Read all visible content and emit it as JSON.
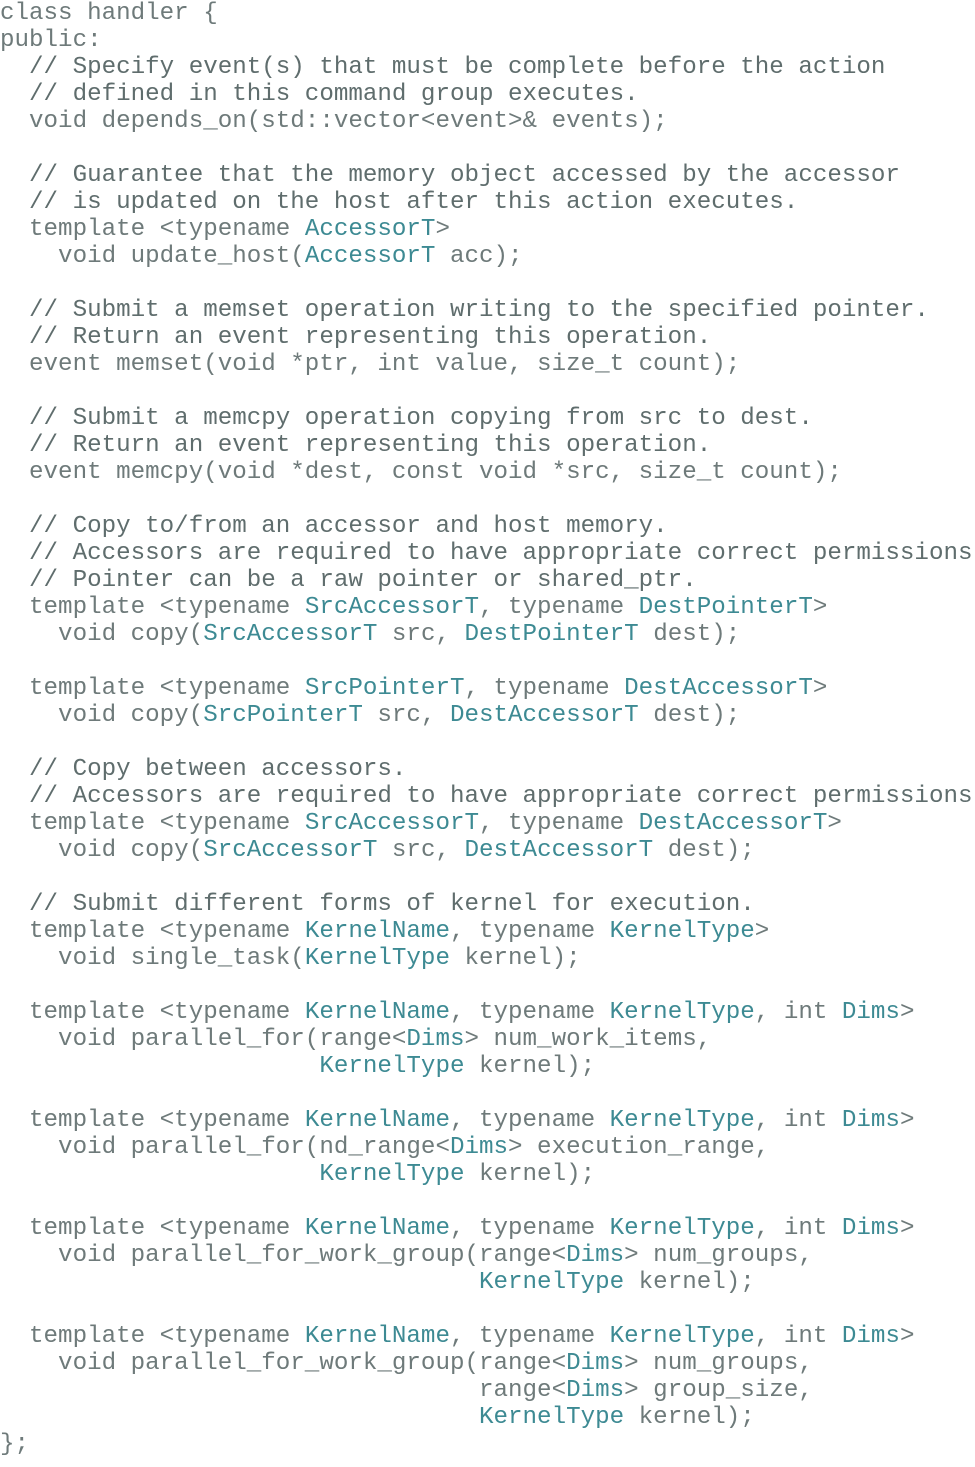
{
  "document": {
    "language": "C++",
    "colors": {
      "text": "#6e7a7a",
      "type_name": "#3d8a93",
      "background": "#ffffff"
    },
    "lines": [
      [
        {
          "t": "class handler {"
        }
      ],
      [
        {
          "t": "public:"
        }
      ],
      [
        {
          "t": "  // Specify event(s) that must be complete before the action",
          "k": "c"
        }
      ],
      [
        {
          "t": "  // defined in this command group executes.",
          "k": "c"
        }
      ],
      [
        {
          "t": "  void depends_on(std::vector<event>& events);"
        }
      ],
      [
        {
          "t": ""
        }
      ],
      [
        {
          "t": "  // Guarantee that the memory object accessed by the accessor",
          "k": "c"
        }
      ],
      [
        {
          "t": "  // is updated on the host after this action executes.",
          "k": "c"
        }
      ],
      [
        {
          "t": "  template <typename "
        },
        {
          "t": "AccessorT",
          "k": "ty"
        },
        {
          "t": ">"
        }
      ],
      [
        {
          "t": "    void update_host("
        },
        {
          "t": "AccessorT",
          "k": "ty"
        },
        {
          "t": " acc);"
        }
      ],
      [
        {
          "t": ""
        }
      ],
      [
        {
          "t": "  // Submit a memset operation writing to the specified pointer.",
          "k": "c"
        }
      ],
      [
        {
          "t": "  // Return an event representing this operation.",
          "k": "c"
        }
      ],
      [
        {
          "t": "  event memset(void *ptr, int value, size_t count);"
        }
      ],
      [
        {
          "t": ""
        }
      ],
      [
        {
          "t": "  // Submit a memcpy operation copying from src to dest.",
          "k": "c"
        }
      ],
      [
        {
          "t": "  // Return an event representing this operation.",
          "k": "c"
        }
      ],
      [
        {
          "t": "  event memcpy(void *dest, const void *src, size_t count);"
        }
      ],
      [
        {
          "t": ""
        }
      ],
      [
        {
          "t": "  // Copy to/from an accessor and host memory.",
          "k": "c"
        }
      ],
      [
        {
          "t": "  // Accessors are required to have appropriate correct permissions.",
          "k": "c"
        }
      ],
      [
        {
          "t": "  // Pointer can be a raw pointer or shared_ptr.",
          "k": "c"
        }
      ],
      [
        {
          "t": "  template <typename "
        },
        {
          "t": "SrcAccessorT",
          "k": "ty"
        },
        {
          "t": ", typename "
        },
        {
          "t": "DestPointerT",
          "k": "ty"
        },
        {
          "t": ">"
        }
      ],
      [
        {
          "t": "    void copy("
        },
        {
          "t": "SrcAccessorT",
          "k": "ty"
        },
        {
          "t": " src, "
        },
        {
          "t": "DestPointerT",
          "k": "ty"
        },
        {
          "t": " dest);"
        }
      ],
      [
        {
          "t": ""
        }
      ],
      [
        {
          "t": "  template <typename "
        },
        {
          "t": "SrcPointerT",
          "k": "ty"
        },
        {
          "t": ", typename "
        },
        {
          "t": "DestAccessorT",
          "k": "ty"
        },
        {
          "t": ">"
        }
      ],
      [
        {
          "t": "    void copy("
        },
        {
          "t": "SrcPointerT",
          "k": "ty"
        },
        {
          "t": " src, "
        },
        {
          "t": "DestAccessorT",
          "k": "ty"
        },
        {
          "t": " dest);"
        }
      ],
      [
        {
          "t": ""
        }
      ],
      [
        {
          "t": "  // Copy between accessors.",
          "k": "c"
        }
      ],
      [
        {
          "t": "  // Accessors are required to have appropriate correct permissions.",
          "k": "c"
        }
      ],
      [
        {
          "t": "  template <typename "
        },
        {
          "t": "SrcAccessorT",
          "k": "ty"
        },
        {
          "t": ", typename "
        },
        {
          "t": "DestAccessorT",
          "k": "ty"
        },
        {
          "t": ">"
        }
      ],
      [
        {
          "t": "    void copy("
        },
        {
          "t": "SrcAccessorT",
          "k": "ty"
        },
        {
          "t": " src, "
        },
        {
          "t": "DestAccessorT",
          "k": "ty"
        },
        {
          "t": " dest);"
        }
      ],
      [
        {
          "t": ""
        }
      ],
      [
        {
          "t": "  // Submit different forms of kernel for execution.",
          "k": "c"
        }
      ],
      [
        {
          "t": "  template <typename "
        },
        {
          "t": "KernelName",
          "k": "ty"
        },
        {
          "t": ", typename "
        },
        {
          "t": "KernelType",
          "k": "ty"
        },
        {
          "t": ">"
        }
      ],
      [
        {
          "t": "    void single_task("
        },
        {
          "t": "KernelType",
          "k": "ty"
        },
        {
          "t": " kernel);"
        }
      ],
      [
        {
          "t": ""
        }
      ],
      [
        {
          "t": "  template <typename "
        },
        {
          "t": "KernelName",
          "k": "ty"
        },
        {
          "t": ", typename "
        },
        {
          "t": "KernelType",
          "k": "ty"
        },
        {
          "t": ", int "
        },
        {
          "t": "Dims",
          "k": "ty"
        },
        {
          "t": ">"
        }
      ],
      [
        {
          "t": "    void parallel_for(range<"
        },
        {
          "t": "Dims",
          "k": "ty"
        },
        {
          "t": "> num_work_items,"
        }
      ],
      [
        {
          "t": "                      "
        },
        {
          "t": "KernelType",
          "k": "ty"
        },
        {
          "t": " kernel);"
        }
      ],
      [
        {
          "t": ""
        }
      ],
      [
        {
          "t": "  template <typename "
        },
        {
          "t": "KernelName",
          "k": "ty"
        },
        {
          "t": ", typename "
        },
        {
          "t": "KernelType",
          "k": "ty"
        },
        {
          "t": ", int "
        },
        {
          "t": "Dims",
          "k": "ty"
        },
        {
          "t": ">"
        }
      ],
      [
        {
          "t": "    void parallel_for(nd_range<"
        },
        {
          "t": "Dims",
          "k": "ty"
        },
        {
          "t": "> execution_range,"
        }
      ],
      [
        {
          "t": "                      "
        },
        {
          "t": "KernelType",
          "k": "ty"
        },
        {
          "t": " kernel);"
        }
      ],
      [
        {
          "t": ""
        }
      ],
      [
        {
          "t": "  template <typename "
        },
        {
          "t": "KernelName",
          "k": "ty"
        },
        {
          "t": ", typename "
        },
        {
          "t": "KernelType",
          "k": "ty"
        },
        {
          "t": ", int "
        },
        {
          "t": "Dims",
          "k": "ty"
        },
        {
          "t": ">"
        }
      ],
      [
        {
          "t": "    void parallel_for_work_group(range<"
        },
        {
          "t": "Dims",
          "k": "ty"
        },
        {
          "t": "> num_groups,"
        }
      ],
      [
        {
          "t": "                                 "
        },
        {
          "t": "KernelType",
          "k": "ty"
        },
        {
          "t": " kernel);"
        }
      ],
      [
        {
          "t": ""
        }
      ],
      [
        {
          "t": "  template <typename "
        },
        {
          "t": "KernelName",
          "k": "ty"
        },
        {
          "t": ", typename "
        },
        {
          "t": "KernelType",
          "k": "ty"
        },
        {
          "t": ", int "
        },
        {
          "t": "Dims",
          "k": "ty"
        },
        {
          "t": ">"
        }
      ],
      [
        {
          "t": "    void parallel_for_work_group(range<"
        },
        {
          "t": "Dims",
          "k": "ty"
        },
        {
          "t": "> num_groups,"
        }
      ],
      [
        {
          "t": "                                 range<"
        },
        {
          "t": "Dims",
          "k": "ty"
        },
        {
          "t": "> group_size,"
        }
      ],
      [
        {
          "t": "                                 "
        },
        {
          "t": "KernelType",
          "k": "ty"
        },
        {
          "t": " kernel);"
        }
      ],
      [
        {
          "t": "};"
        }
      ]
    ]
  }
}
